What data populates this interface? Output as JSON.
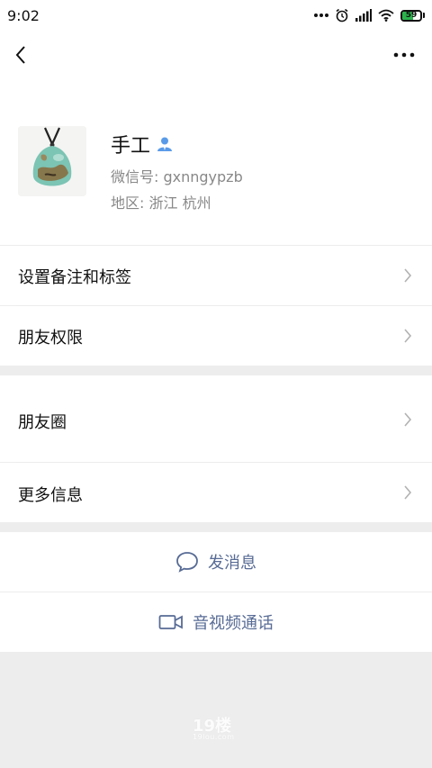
{
  "status_bar": {
    "time": "9:02",
    "battery_level": "59",
    "battery_fill_fraction": 0.59,
    "battery_color": "#2bb24c",
    "icons": [
      "more-dots-icon",
      "alarm-icon",
      "signal-icon",
      "wifi-icon",
      "battery-icon"
    ]
  },
  "nav": {
    "back_icon": "chevron-left-icon",
    "more_icon": "more-horizontal-icon"
  },
  "profile": {
    "name": "手工",
    "wechat_id": "微信号:  gxnngypzb",
    "region": "地区:  浙江  杭州",
    "verified_color": "#5a9be8"
  },
  "menu_group_1": {
    "items": [
      {
        "label": "设置备注和标签"
      },
      {
        "label": "朋友权限"
      }
    ]
  },
  "menu_group_2": {
    "items": [
      {
        "label": "朋友圈"
      },
      {
        "label": "更多信息"
      }
    ]
  },
  "actions": {
    "send_message": "发消息",
    "video_call": "音视频通话",
    "accent_color": "#576b95"
  },
  "watermark": {
    "text": "19楼",
    "subtext": "19lou.com"
  }
}
